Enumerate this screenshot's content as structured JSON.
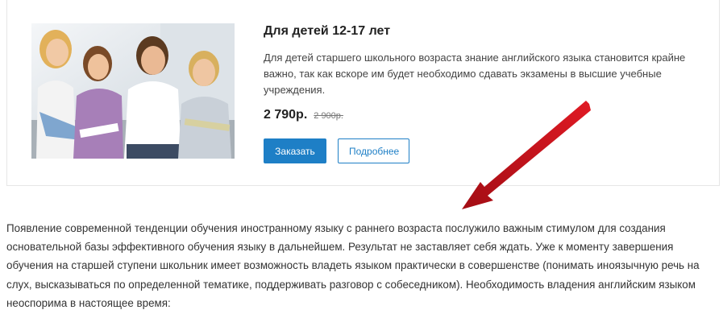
{
  "product": {
    "title": "Для детей 12-17 лет",
    "description": "Для детей старшего школьного возраста знание английского языка становится крайне важно, так как вскоре им будет необходимо сдавать экзамены в высшие учебные учреждения.",
    "price": "2 790р.",
    "old_price": "2 900р.",
    "order_label": "Заказать",
    "more_label": "Подробнее"
  },
  "article": {
    "paragraph": "Появление современной тенденции обучения иностранному языку с раннего возраста послужило важным стимулом для создания основательной базы эффективного обучения языку в дальнейшем. Результат не заставляет себя ждать. Уже к моменту завершения обучения на старшей ступени школьник имеет возможность владеть языком практически в совершенстве (понимать иноязычную речь на слух, высказываться по определенной тематике, поддерживать разговор с собеседником). Необходимость владения английским языком неоспорима в настоящее время:"
  },
  "colors": {
    "accent": "#1e7fc6",
    "arrow": "#c0101a"
  }
}
